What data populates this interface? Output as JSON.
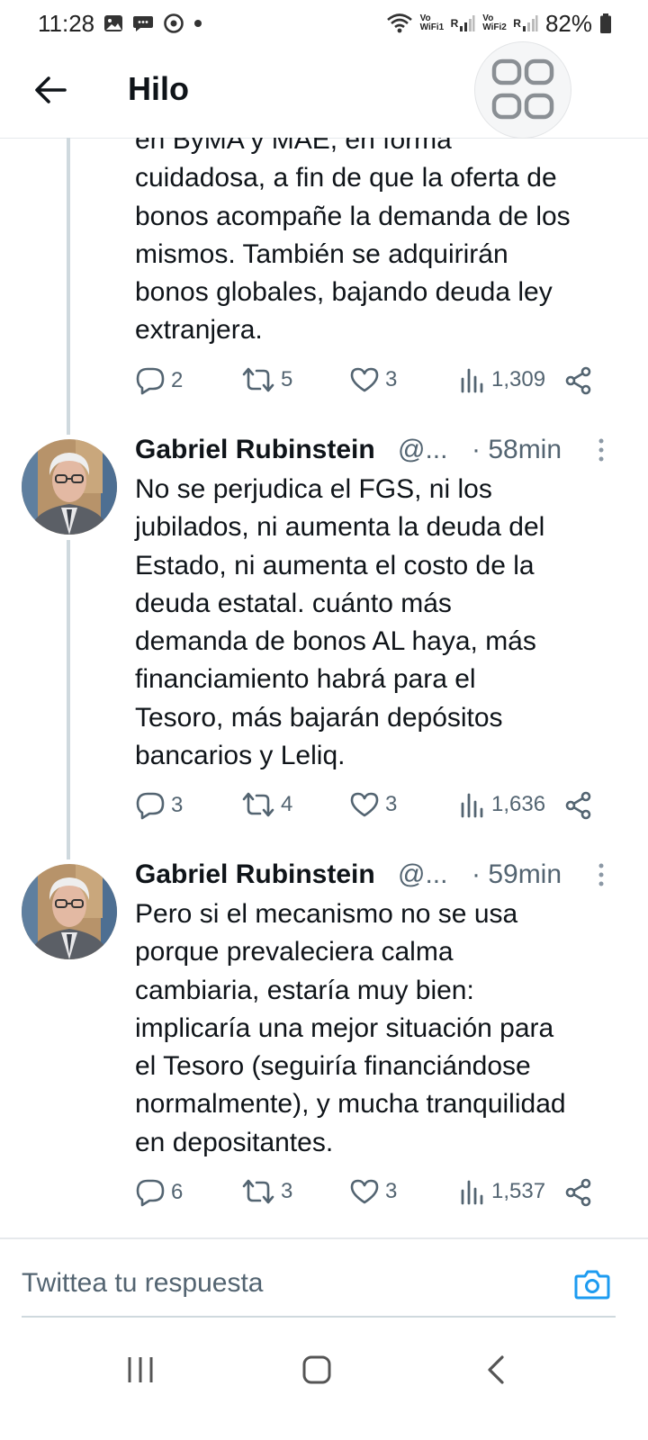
{
  "status_bar": {
    "time": "11:28",
    "battery": "82%",
    "net1_label": "Vo WiFi1",
    "net2_label": "Vo WiFi2",
    "roaming_mark": "R"
  },
  "header": {
    "title": "Hilo"
  },
  "tweets": [
    {
      "text": "en ByMA y MAE, en forma\ncuidadosa, a fin de que la oferta de\nbonos acompañe la demanda de los\nmismos. También se adquirirán\nbonos globales, bajando deuda ley\nextranjera.",
      "replies": "2",
      "retweets": "5",
      "likes": "3",
      "views": "1,309"
    },
    {
      "author": "Gabriel Rubinstein",
      "handle": "@...",
      "time": "· 58min",
      "text": "No se perjudica el FGS, ni los\njubilados, ni aumenta la deuda del\nEstado, ni aumenta el costo de la\ndeuda estatal. cuánto más\ndemanda de bonos AL haya, más\nfinanciamiento habrá para el\nTesoro, más bajarán depósitos\nbancarios y Leliq.",
      "replies": "3",
      "retweets": "4",
      "likes": "3",
      "views": "1,636"
    },
    {
      "author": "Gabriel Rubinstein",
      "handle": "@...",
      "time": "· 59min",
      "text": "Pero si el mecanismo no se usa\nporque prevaleciera calma\ncambiaria, estaría muy bien:\nimplicaría una mejor situación para\nel Tesoro (seguiría financiándose\nnormalmente), y mucha tranquilidad\nen depositantes.",
      "replies": "6",
      "retweets": "3",
      "likes": "3",
      "views": "1,537"
    }
  ],
  "reply": {
    "placeholder": "Twittea tu respuesta"
  },
  "colors": {
    "accent": "#1d9bf0",
    "text": "#0f1419",
    "secondary": "#536471",
    "thread_line": "#cfd9de"
  },
  "icons": [
    "back-arrow-icon",
    "apps-grid-icon",
    "reply-icon",
    "retweet-icon",
    "like-icon",
    "views-icon",
    "share-icon",
    "more-icon",
    "camera-icon",
    "recents-icon",
    "home-icon",
    "back-icon"
  ]
}
